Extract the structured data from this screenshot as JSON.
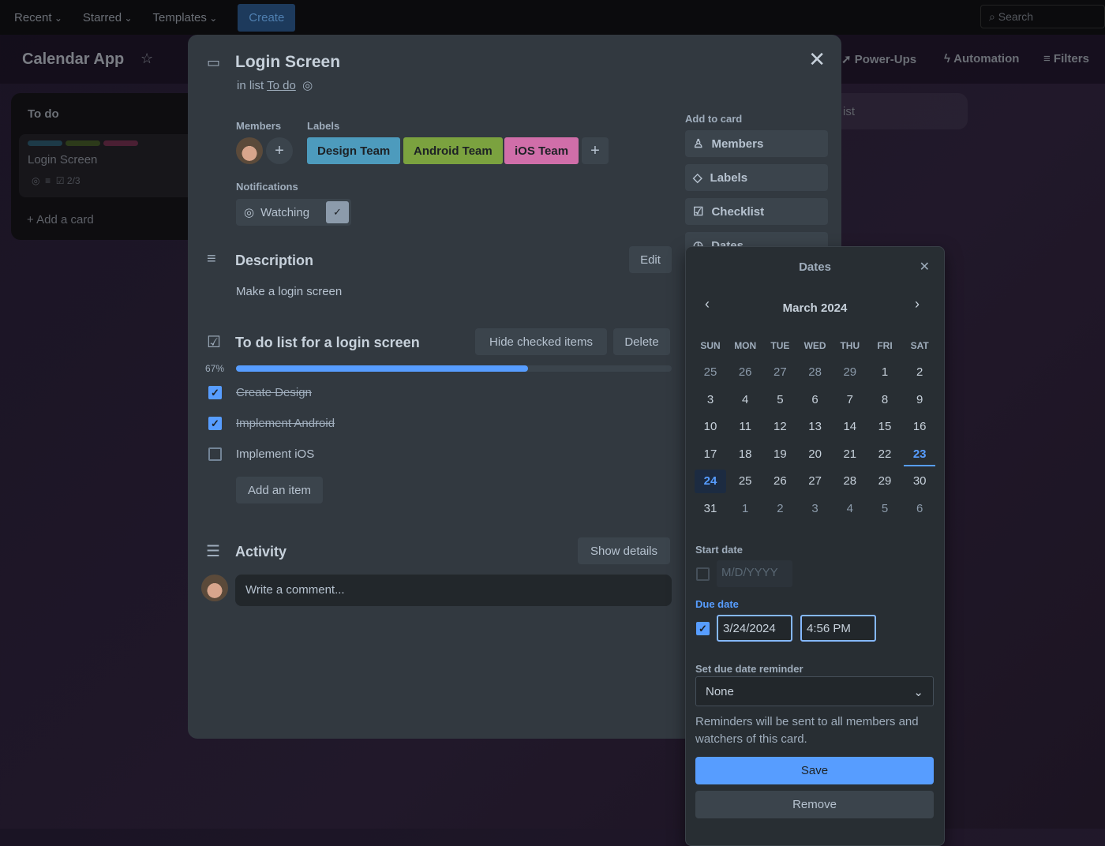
{
  "topbar": {
    "recent": "Recent",
    "starred": "Starred",
    "templates": "Templates",
    "create": "Create",
    "search": "Search"
  },
  "board": {
    "title": "Calendar App",
    "power_ups": "Power-Ups",
    "automation": "Automation",
    "filters": "Filters",
    "add_list": "ist",
    "list": {
      "title": "To do",
      "card_title": "Login Screen",
      "checklist_badge": "2/3",
      "add_card": "Add a card"
    }
  },
  "card": {
    "title": "Login Screen",
    "in_list_prefix": "in list",
    "list_name": "To do",
    "members_label": "Members",
    "labels_label": "Labels",
    "labels": [
      {
        "text": "Design Team",
        "color": "#4d9bbd"
      },
      {
        "text": "Android Team",
        "color": "#7ba23f"
      },
      {
        "text": "iOS Team",
        "color": "#d06ea9"
      }
    ],
    "notifications_label": "Notifications",
    "watching": "Watching",
    "description_title": "Description",
    "edit": "Edit",
    "description": "Make a login screen",
    "checklist": {
      "title": "To do list for a login screen",
      "hide_checked": "Hide checked items",
      "delete": "Delete",
      "progress_label": "67%",
      "progress": 0.67,
      "items": [
        {
          "text": "Create Design",
          "checked": true
        },
        {
          "text": "Implement Android",
          "checked": true
        },
        {
          "text": "Implement iOS",
          "checked": false
        }
      ],
      "add_item": "Add an item"
    },
    "activity_title": "Activity",
    "show_details": "Show details",
    "comment_placeholder": "Write a comment...",
    "add_to_card": "Add to card",
    "side_buttons": [
      "Members",
      "Labels",
      "Checklist",
      "Dates"
    ]
  },
  "dates": {
    "title": "Dates",
    "month": "March 2024",
    "dow": [
      "SUN",
      "MON",
      "TUE",
      "WED",
      "THU",
      "FRI",
      "SAT"
    ],
    "weeks": [
      [
        "25",
        "26",
        "27",
        "28",
        "29",
        "1",
        "2"
      ],
      [
        "3",
        "4",
        "5",
        "6",
        "7",
        "8",
        "9"
      ],
      [
        "10",
        "11",
        "12",
        "13",
        "14",
        "15",
        "16"
      ],
      [
        "17",
        "18",
        "19",
        "20",
        "21",
        "22",
        "23"
      ],
      [
        "24",
        "25",
        "26",
        "27",
        "28",
        "29",
        "30"
      ],
      [
        "31",
        "1",
        "2",
        "3",
        "4",
        "5",
        "6"
      ]
    ],
    "start_date_label": "Start date",
    "start_placeholder": "M/D/YYYY",
    "due_date_label": "Due date",
    "due_date": "3/24/2024",
    "due_time": "4:56 PM",
    "reminder_label": "Set due date reminder",
    "reminder": "None",
    "reminder_note": "Reminders will be sent to all members and watchers of this card.",
    "save": "Save",
    "remove": "Remove"
  }
}
